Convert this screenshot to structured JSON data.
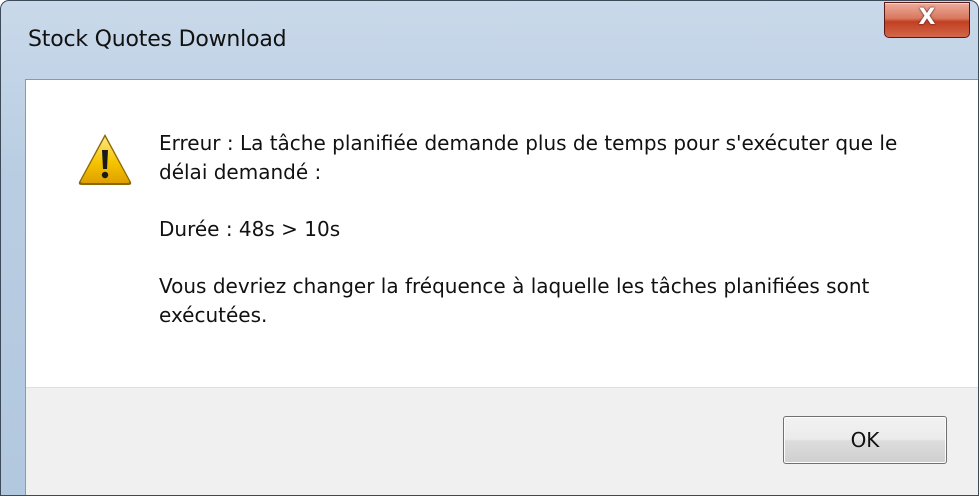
{
  "window": {
    "title": "Stock Quotes Download",
    "close_glyph": "X"
  },
  "message": {
    "icon": "warning-icon",
    "line1": "Erreur : La tâche planifiée demande plus de temps pour s'exécuter que le délai demandé :",
    "line2": "Durée : 48s > 10s",
    "line3": "Vous devriez changer la fréquence à laquelle les tâches planifiées sont exécutées."
  },
  "buttons": {
    "ok_label": "OK"
  },
  "colors": {
    "frame": "#b9cde2",
    "close_button": "#c8452a",
    "warning_yellow": "#f5c400",
    "footer": "#f0f0f0"
  }
}
